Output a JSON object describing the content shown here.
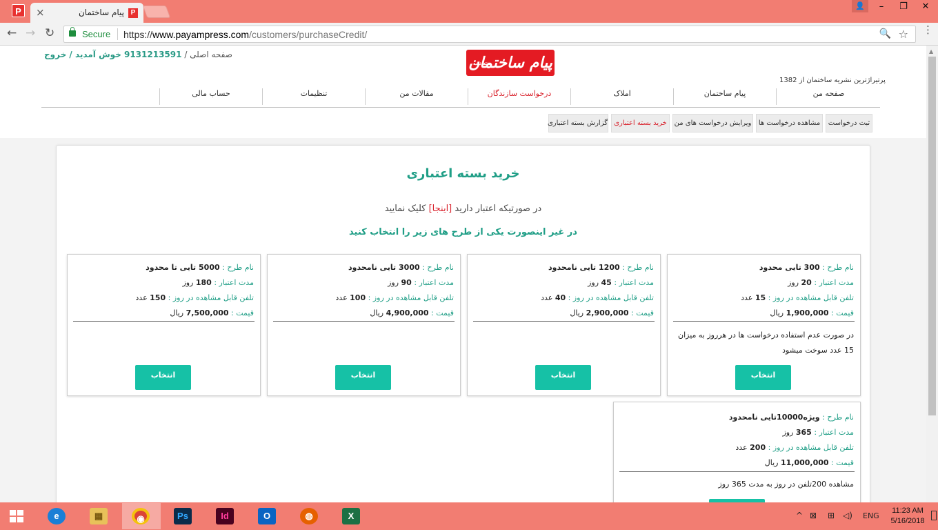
{
  "browser": {
    "tab_title": "پیام ساختمان",
    "tab_close": "×",
    "app_icon_letter": "P",
    "win_min": "–",
    "win_max": "❐",
    "win_close": "✕",
    "user_icon": "👤",
    "secure_label": "Secure",
    "url_scheme": "https://",
    "url_host": "www.payampress.com",
    "url_path": "/customers/purchaseCredit/",
    "back": "←",
    "forward": "→",
    "reload": "↻",
    "zoom": "🔍",
    "star": "☆",
    "menu": "⋮"
  },
  "header": {
    "breadcrumb_home": "صفحه اصلی /",
    "welcome": "9131213591 خوش آمدید",
    "sep": " / ",
    "logout": "خروج",
    "logo_text": "پیام ساختمان",
    "logo_small": "هفته نامه",
    "tagline": "پرتیراژترین نشریه ساختمان از 1382"
  },
  "main_nav": [
    {
      "label": "صفحه من"
    },
    {
      "label": "پیام ساختمان"
    },
    {
      "label": "املاک"
    },
    {
      "label": "درخواست سازندگان"
    },
    {
      "label": "مقالات من"
    },
    {
      "label": "تنظیمات"
    },
    {
      "label": "حساب مالی"
    }
  ],
  "sub_nav": [
    {
      "label": "ثبت درخواست"
    },
    {
      "label": "مشاهده درخواست ها"
    },
    {
      "label": "ویرایش درخواست های من"
    },
    {
      "label": "خرید بسته اعتباری"
    },
    {
      "label": "گزارش بسته اعتباری"
    }
  ],
  "content": {
    "title": "خرید بسته اعتباری",
    "credit_note_pre": "در صورتیکه اعتبار دارید ",
    "credit_note_link": "[اینجا]",
    "credit_note_post": " کلیک نمایید",
    "choose_note": "در غیر اینصورت یکی از طرح های زیر را انتخاب کنید"
  },
  "labels": {
    "plan_name": "نام طرح :",
    "duration": "مدت اعتبار :",
    "phones": "تلفن قابل مشاهده در روز :",
    "price": "قیمت :",
    "day": "روز",
    "count": "عدد",
    "rial": "ریال",
    "select": "انتخاب"
  },
  "plans": [
    {
      "name": "300 تایی محدود",
      "duration": "20",
      "phones": "15",
      "price": "1,900,000",
      "note": "در صورت عدم استفاده درخواست ها در هرروز به میزان 15 عدد سوخت میشود"
    },
    {
      "name": "1200 تایی نامحدود",
      "duration": "45",
      "phones": "40",
      "price": "2,900,000",
      "note": ""
    },
    {
      "name": "3000 تایی نامحدود",
      "duration": "90",
      "phones": "100",
      "price": "4,900,000",
      "note": ""
    },
    {
      "name": "5000 تایی تا محدود",
      "duration": "180",
      "phones": "150",
      "price": "7,500,000",
      "note": ""
    },
    {
      "name": "ویژه10000تایی نامحدود",
      "duration": "365",
      "phones": "200",
      "price": "11,000,000",
      "note": "مشاهده 200تلفن در روز به مدت 365 روز"
    }
  ],
  "taskbar": {
    "apps": [
      "e",
      "▦",
      "◉",
      "Ps",
      "Id",
      "O",
      "◍",
      "X"
    ],
    "lang": "ENG",
    "time": "11:23 AM",
    "date": "5/16/2018",
    "tray_up": "^",
    "tray_net": "⊠",
    "tray_vol": "◁)"
  },
  "colors": {
    "accent_teal": "#1f9e86",
    "button_teal": "#16c1a6",
    "brand_red": "#e41b23",
    "chrome_salmon": "#f27d72"
  }
}
